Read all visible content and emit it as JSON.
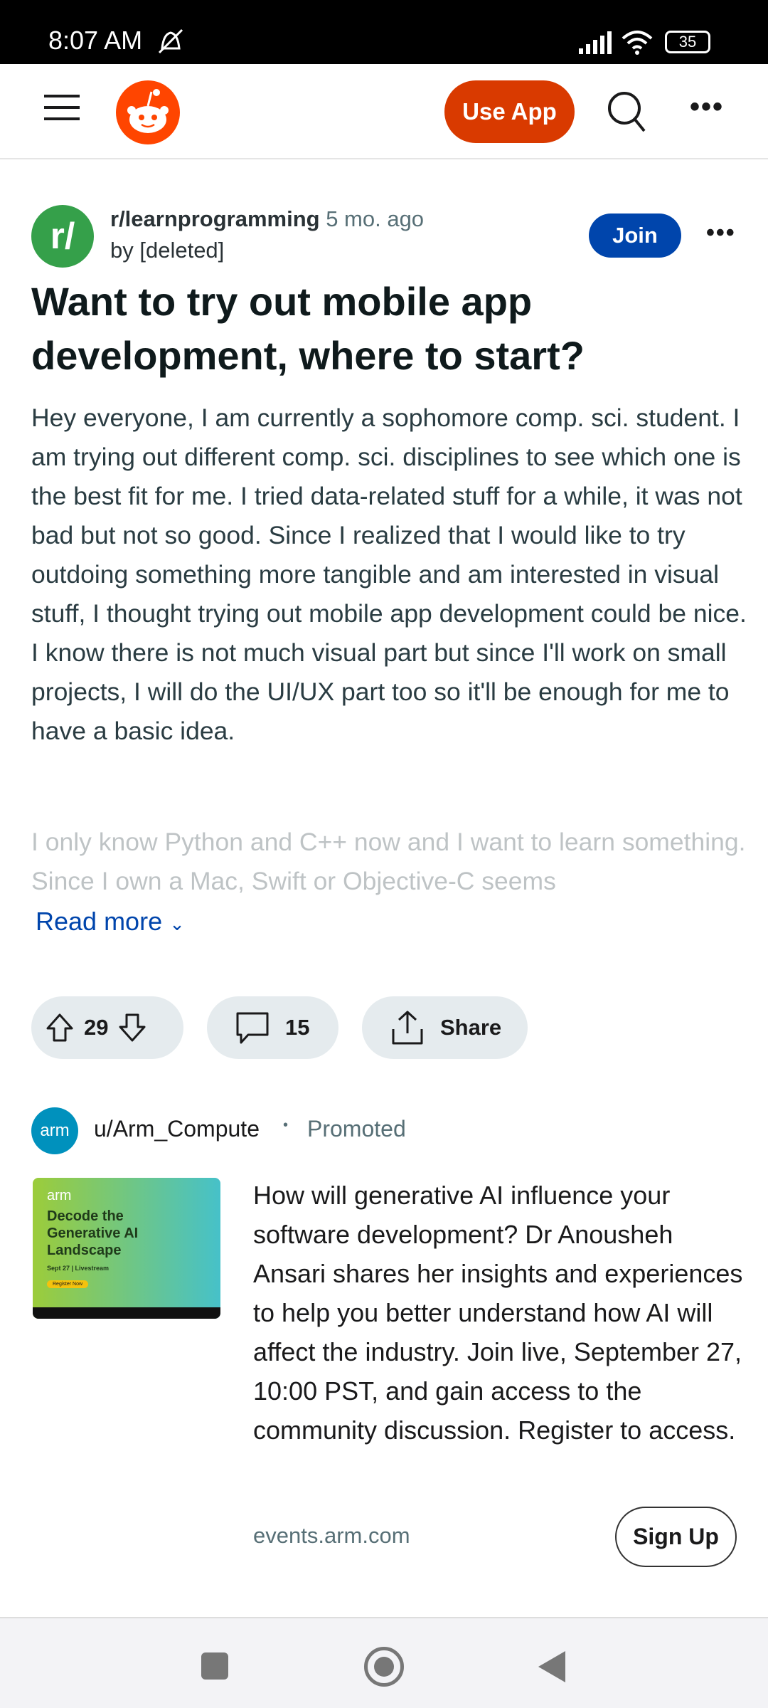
{
  "status_bar": {
    "time": "8:07 AM",
    "battery": "35"
  },
  "header": {
    "use_app": "Use App"
  },
  "post": {
    "subreddit": "r/learnprogramming",
    "avatar_text": "r/",
    "age": "5 mo. ago",
    "author": "by [deleted]",
    "join": "Join",
    "title": "Want to try out mobile app development, where to start?",
    "body": "Hey everyone, I am currently a sophomore comp. sci. student. I am trying out different comp. sci. disciplines to see which one is the best fit for me. I tried data-related stuff for a while, it was not bad but not so good. Since I realized that I would like to try outdoing something more tangible and am interested in visual stuff, I thought trying out mobile app development could be nice. I know there is not much visual part but since I'll work on small projects, I will do the UI/UX part too so it'll be enough for me to have a basic idea.",
    "body_faded": "I only know Python and C++ now and I want to learn something. Since I own a Mac, Swift or Objective-C seems",
    "read_more": "Read more",
    "votes": "29",
    "comments": "15",
    "share": "Share"
  },
  "ad": {
    "avatar_text": "arm",
    "user": "u/Arm_Compute",
    "promoted": "Promoted",
    "image": {
      "brand": "arm",
      "headline": "Decode the Generative AI Landscape",
      "date": "Sept 27 | Livestream",
      "cta": "Register Now"
    },
    "text": "How will generative AI influence your software development? Dr Anousheh Ansari shares her insights and experiences to help you better understand how AI will affect the industry. Join live, September 27, 10:00 PST, and gain access to the community discussion. Register to access.",
    "domain": "events.arm.com",
    "signup": "Sign Up"
  },
  "colors": {
    "reddit_orange": "#ff4500",
    "use_app": "#d93a00",
    "join": "#0045ac",
    "subreddit": "#35a04a"
  }
}
